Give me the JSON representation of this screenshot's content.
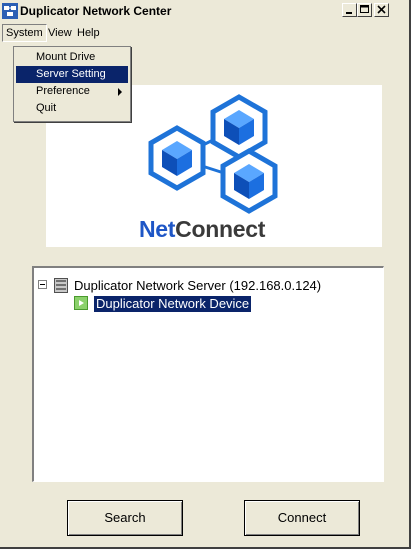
{
  "window": {
    "title": "Duplicator Network Center"
  },
  "menubar": {
    "items": [
      "System",
      "View",
      "Help"
    ]
  },
  "system_menu": {
    "items": [
      "Mount Drive",
      "Server Setting",
      "Preference",
      "Quit"
    ],
    "highlighted": "Server Setting"
  },
  "logo": {
    "brand_part1": "Net",
    "brand_part2": "Connect",
    "colors": {
      "hex_blue": "#1e73d8",
      "net_text": "#1e56c6",
      "connect_text": "#3a3a3a"
    }
  },
  "tree": {
    "server": {
      "label": "Duplicator Network Server (192.168.0.124)",
      "icon": "server-icon"
    },
    "device": {
      "label": "Duplicator Network Device",
      "icon": "device-icon",
      "selected": true
    }
  },
  "buttons": {
    "search": "Search",
    "connect": "Connect"
  }
}
